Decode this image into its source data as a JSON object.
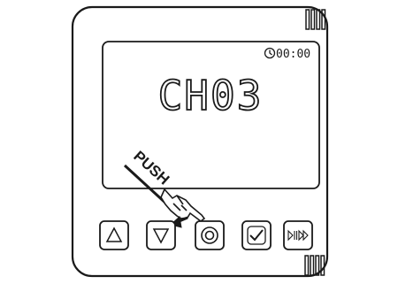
{
  "display": {
    "channel_text": "CH03",
    "clock_text": "00:00",
    "clock_icon": "clock-icon"
  },
  "annotation": {
    "push_label": "PUSH",
    "pointer_icon": "hand-pointer-icon",
    "arrow_icon": "arrow-icon"
  },
  "buttons": [
    {
      "name": "up-button",
      "icon": "triangle-up-icon"
    },
    {
      "name": "down-button",
      "icon": "triangle-down-icon"
    },
    {
      "name": "ok-button",
      "icon": "circle-target-icon"
    },
    {
      "name": "confirm-button",
      "icon": "checkmark-icon"
    },
    {
      "name": "play-pause-button",
      "icon": "play-pause-icon"
    }
  ],
  "colors": {
    "stroke": "#1a1a1a",
    "background": "#ffffff"
  }
}
